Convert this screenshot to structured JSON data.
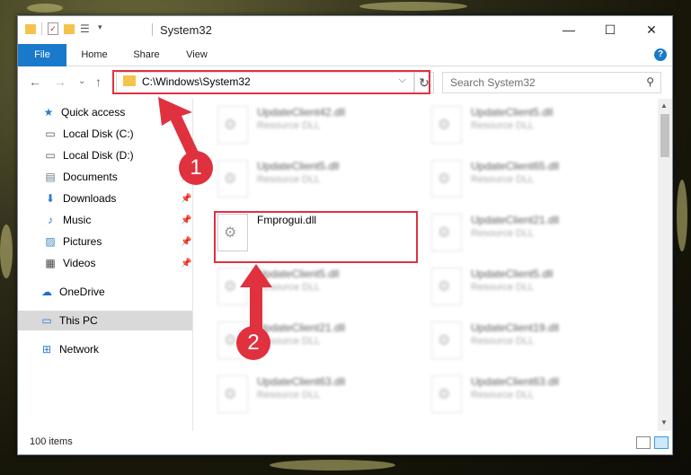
{
  "window": {
    "title": "System32",
    "minimize": "—",
    "maximize": "☐",
    "close": "✕"
  },
  "ribbon": {
    "file": "File",
    "home": "Home",
    "share": "Share",
    "view": "View",
    "help": "?"
  },
  "nav": {
    "back": "←",
    "forward": "→",
    "recent": "⌄",
    "up": "↑",
    "address": "C:\\Windows\\System32",
    "refresh": "↻",
    "search_placeholder": "Search System32"
  },
  "sidebar": {
    "items": [
      {
        "label": "Quick access",
        "icon": "star-icon"
      },
      {
        "label": "Local Disk (C:)",
        "icon": "drive-icon"
      },
      {
        "label": "Local Disk (D:)",
        "icon": "drive-icon"
      },
      {
        "label": "Documents",
        "icon": "documents-icon"
      },
      {
        "label": "Downloads",
        "icon": "downloads-icon"
      },
      {
        "label": "Music",
        "icon": "music-icon"
      },
      {
        "label": "Pictures",
        "icon": "pictures-icon"
      },
      {
        "label": "Videos",
        "icon": "videos-icon"
      },
      {
        "label": "OneDrive",
        "icon": "cloud-icon"
      },
      {
        "label": "This PC",
        "icon": "computer-icon"
      },
      {
        "label": "Network",
        "icon": "network-icon"
      }
    ]
  },
  "files": {
    "left": [
      {
        "name": "UpdateClient42.dll",
        "type": "Resource DLL"
      },
      {
        "name": "UpdateClient5.dll",
        "type": "Resource DLL"
      },
      {
        "name": "Fmprogui.dll",
        "type": ""
      },
      {
        "name": "UpdateClient5.dll",
        "type": "Resource DLL"
      },
      {
        "name": "UpdateClient21.dll",
        "type": "Resource DLL"
      },
      {
        "name": "UpdateClient63.dll",
        "type": "Resource DLL"
      }
    ],
    "right": [
      {
        "name": "UpdateClient5.dll",
        "type": "Resource DLL"
      },
      {
        "name": "UpdateClient65.dll",
        "type": "Resource DLL"
      },
      {
        "name": "UpdateClient21.dll",
        "type": "Resource DLL"
      },
      {
        "name": "UpdateClient5.dll",
        "type": "Resource DLL"
      },
      {
        "name": "UpdateClient19.dll",
        "type": "Resource DLL"
      },
      {
        "name": "UpdateClient63.dll",
        "type": "Resource DLL"
      }
    ]
  },
  "status": {
    "count": "100 items"
  },
  "annotations": {
    "step1": "1",
    "step2": "2",
    "color": "#e0313f"
  }
}
